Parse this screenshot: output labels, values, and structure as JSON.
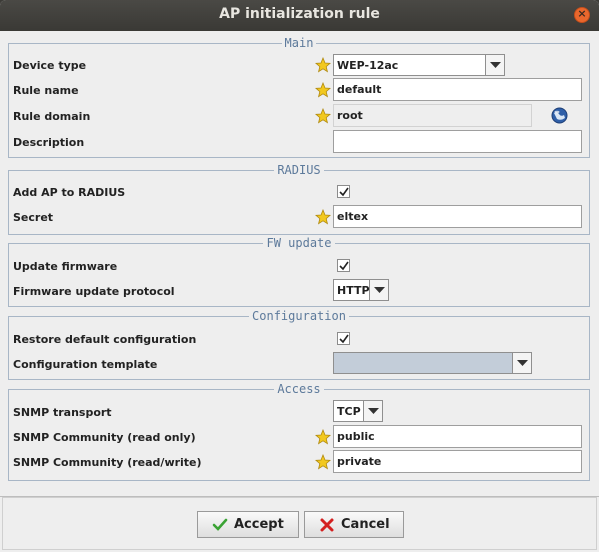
{
  "window": {
    "title": "AP initialization rule"
  },
  "sections": {
    "main": "Main",
    "radius": "RADIUS",
    "fw": "FW update",
    "config": "Configuration",
    "access": "Access"
  },
  "main": {
    "device_type_label": "Device type",
    "device_type_value": "WEP-12ac",
    "rule_name_label": "Rule name",
    "rule_name_value": "default",
    "rule_domain_label": "Rule domain",
    "rule_domain_value": "root",
    "description_label": "Description",
    "description_value": ""
  },
  "radius": {
    "add_ap_label": "Add AP to RADIUS",
    "add_ap_checked": true,
    "secret_label": "Secret",
    "secret_value": "eltex"
  },
  "fw": {
    "update_label": "Update firmware",
    "update_checked": true,
    "protocol_label": "Firmware update protocol",
    "protocol_value": "HTTP"
  },
  "config": {
    "restore_label": "Restore default configuration",
    "restore_checked": true,
    "template_label": "Configuration template",
    "template_value": ""
  },
  "access": {
    "transport_label": "SNMP transport",
    "transport_value": "TCP",
    "ro_label": "SNMP Community (read only)",
    "ro_value": "public",
    "rw_label": "SNMP Community (read/write)",
    "rw_value": "private"
  },
  "buttons": {
    "accept": "Accept",
    "cancel": "Cancel"
  },
  "colors": {
    "accent": "#5d7a9b",
    "star": "#f2c81e",
    "accept_icon": "#3aa334",
    "cancel_icon": "#d42020"
  },
  "icons": {
    "required": "star-icon",
    "domain_picker": "globe-icon",
    "accept": "check-icon",
    "cancel": "x-icon"
  }
}
